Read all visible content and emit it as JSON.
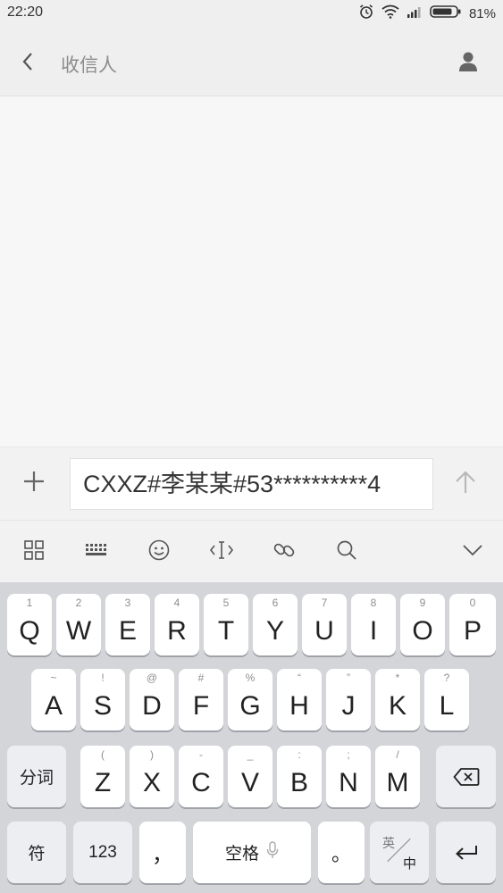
{
  "status": {
    "time": "22:20",
    "battery": "81%",
    "icons": [
      "alarm-icon",
      "wifi-icon",
      "signal-icon",
      "battery-icon"
    ]
  },
  "header": {
    "recipient_placeholder": "收信人",
    "back_icon": "chevron-left-icon",
    "contact_icon": "person-icon"
  },
  "compose": {
    "text": "CXXZ#李某某#53**********4",
    "add_icon": "plus-icon",
    "send_icon": "arrow-up-icon"
  },
  "ime_toolbar": {
    "items": [
      "grid-icon",
      "keyboard-icon",
      "emoji-icon",
      "cursor-icon",
      "link-icon",
      "search-icon",
      "chevron-down-icon"
    ]
  },
  "keyboard": {
    "row1": [
      {
        "key": "Q",
        "hint": "1"
      },
      {
        "key": "W",
        "hint": "2"
      },
      {
        "key": "E",
        "hint": "3"
      },
      {
        "key": "R",
        "hint": "4"
      },
      {
        "key": "T",
        "hint": "5"
      },
      {
        "key": "Y",
        "hint": "6"
      },
      {
        "key": "U",
        "hint": "7"
      },
      {
        "key": "I",
        "hint": "8"
      },
      {
        "key": "O",
        "hint": "9"
      },
      {
        "key": "P",
        "hint": "0"
      }
    ],
    "row2": [
      {
        "key": "A",
        "hint": "~"
      },
      {
        "key": "S",
        "hint": "!"
      },
      {
        "key": "D",
        "hint": "@"
      },
      {
        "key": "F",
        "hint": "#"
      },
      {
        "key": "G",
        "hint": "%"
      },
      {
        "key": "H",
        "hint": "“"
      },
      {
        "key": "J",
        "hint": "”"
      },
      {
        "key": "K",
        "hint": "*"
      },
      {
        "key": "L",
        "hint": "?"
      }
    ],
    "row3": [
      {
        "key": "Z",
        "hint": "("
      },
      {
        "key": "X",
        "hint": ")"
      },
      {
        "key": "C",
        "hint": "-"
      },
      {
        "key": "V",
        "hint": "_"
      },
      {
        "key": "B",
        "hint": ":"
      },
      {
        "key": "N",
        "hint": ";"
      },
      {
        "key": "M",
        "hint": "/"
      }
    ],
    "fenci": "分词",
    "symbols": "符",
    "numbers": "123",
    "comma": "，",
    "space": "空格",
    "period": "。",
    "lang_en": "英",
    "lang_zh": "中",
    "delete_icon": "backspace-icon",
    "enter_icon": "enter-icon"
  }
}
